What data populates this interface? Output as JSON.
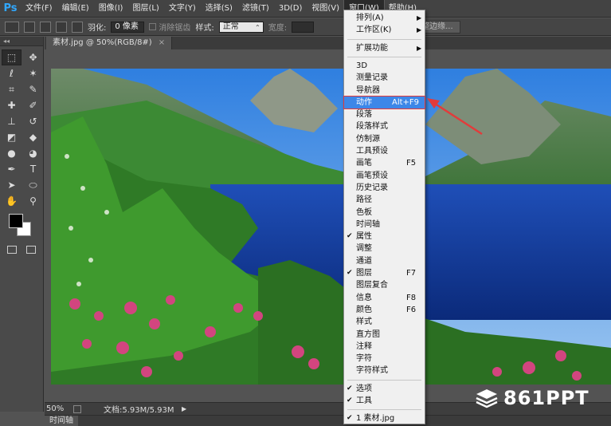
{
  "app": {
    "logo": "Ps"
  },
  "menubar": {
    "items": [
      "文件(F)",
      "编辑(E)",
      "图像(I)",
      "图层(L)",
      "文字(Y)",
      "选择(S)",
      "滤镜(T)",
      "3D(D)",
      "视图(V)",
      "窗口(W)",
      "帮助(H)"
    ],
    "active_index": 9
  },
  "options_bar": {
    "feather_label": "羽化:",
    "feather_value": "0 像素",
    "antialias_label": "消除锯齿",
    "style_label": "样式:",
    "style_value": "正常",
    "width_label": "宽度:",
    "refine_edge_button": "调整边缘..."
  },
  "document": {
    "tab_title": "素材.jpg @ 50%(RGB/8#)",
    "close_glyph": "×"
  },
  "status_bar": {
    "zoom": "50%",
    "doc_info": "文档:5.93M/5.93M",
    "arrow_glyph": "▶"
  },
  "timeline_tab": "时间轴",
  "window_menu": {
    "items": [
      {
        "label": "排列(A)",
        "submenu": true
      },
      {
        "label": "工作区(K)",
        "submenu": true
      },
      {
        "sep": true
      },
      {
        "label": "扩展功能",
        "submenu": true
      },
      {
        "sep": true
      },
      {
        "label": "3D"
      },
      {
        "label": "测量记录"
      },
      {
        "label": "导航器"
      },
      {
        "label": "动作",
        "shortcut": "Alt+F9",
        "highlight": true
      },
      {
        "label": "段落"
      },
      {
        "label": "段落样式"
      },
      {
        "label": "仿制源"
      },
      {
        "label": "工具预设"
      },
      {
        "label": "画笔",
        "shortcut": "F5"
      },
      {
        "label": "画笔预设"
      },
      {
        "label": "历史记录"
      },
      {
        "label": "路径"
      },
      {
        "label": "色板"
      },
      {
        "label": "时间轴"
      },
      {
        "label": "属性",
        "checked": true
      },
      {
        "label": "调整"
      },
      {
        "label": "通道"
      },
      {
        "label": "图层",
        "shortcut": "F7",
        "checked": true
      },
      {
        "label": "图层复合"
      },
      {
        "label": "信息",
        "shortcut": "F8"
      },
      {
        "label": "颜色",
        "shortcut": "F6"
      },
      {
        "label": "样式"
      },
      {
        "label": "直方图"
      },
      {
        "label": "注释"
      },
      {
        "label": "字符"
      },
      {
        "label": "字符样式"
      },
      {
        "sep": true
      },
      {
        "label": "选项",
        "checked": true
      },
      {
        "label": "工具",
        "checked": true
      },
      {
        "sep": true
      },
      {
        "label": "1 素材.jpg",
        "checked": true
      }
    ],
    "check_glyph": "✔",
    "submenu_glyph": "▶"
  },
  "tools": [
    {
      "name": "marquee-tool",
      "glyph": "⬚"
    },
    {
      "name": "move-tool",
      "glyph": "✥"
    },
    {
      "name": "lasso-tool",
      "glyph": "ℓ"
    },
    {
      "name": "magic-wand-tool",
      "glyph": "✶"
    },
    {
      "name": "crop-tool",
      "glyph": "⌗"
    },
    {
      "name": "eyedropper-tool",
      "glyph": "✎"
    },
    {
      "name": "healing-tool",
      "glyph": "✚"
    },
    {
      "name": "brush-tool",
      "glyph": "✐"
    },
    {
      "name": "clone-stamp-tool",
      "glyph": "⊥"
    },
    {
      "name": "history-brush-tool",
      "glyph": "↺"
    },
    {
      "name": "eraser-tool",
      "glyph": "◩"
    },
    {
      "name": "paint-bucket-tool",
      "glyph": "◆"
    },
    {
      "name": "blur-tool",
      "glyph": "●"
    },
    {
      "name": "dodge-tool",
      "glyph": "◕"
    },
    {
      "name": "pen-tool",
      "glyph": "✒"
    },
    {
      "name": "type-tool",
      "glyph": "T"
    },
    {
      "name": "path-selection-tool",
      "glyph": "➤"
    },
    {
      "name": "shape-tool",
      "glyph": "⬭"
    },
    {
      "name": "hand-tool",
      "glyph": "✋"
    },
    {
      "name": "zoom-tool",
      "glyph": "⚲"
    }
  ],
  "colors": {
    "foreground": "#000000",
    "background": "#ffffff",
    "menu_highlight": "#3d87e8",
    "annotation": "#e23b3b"
  },
  "watermark": {
    "text": "861PPT"
  }
}
